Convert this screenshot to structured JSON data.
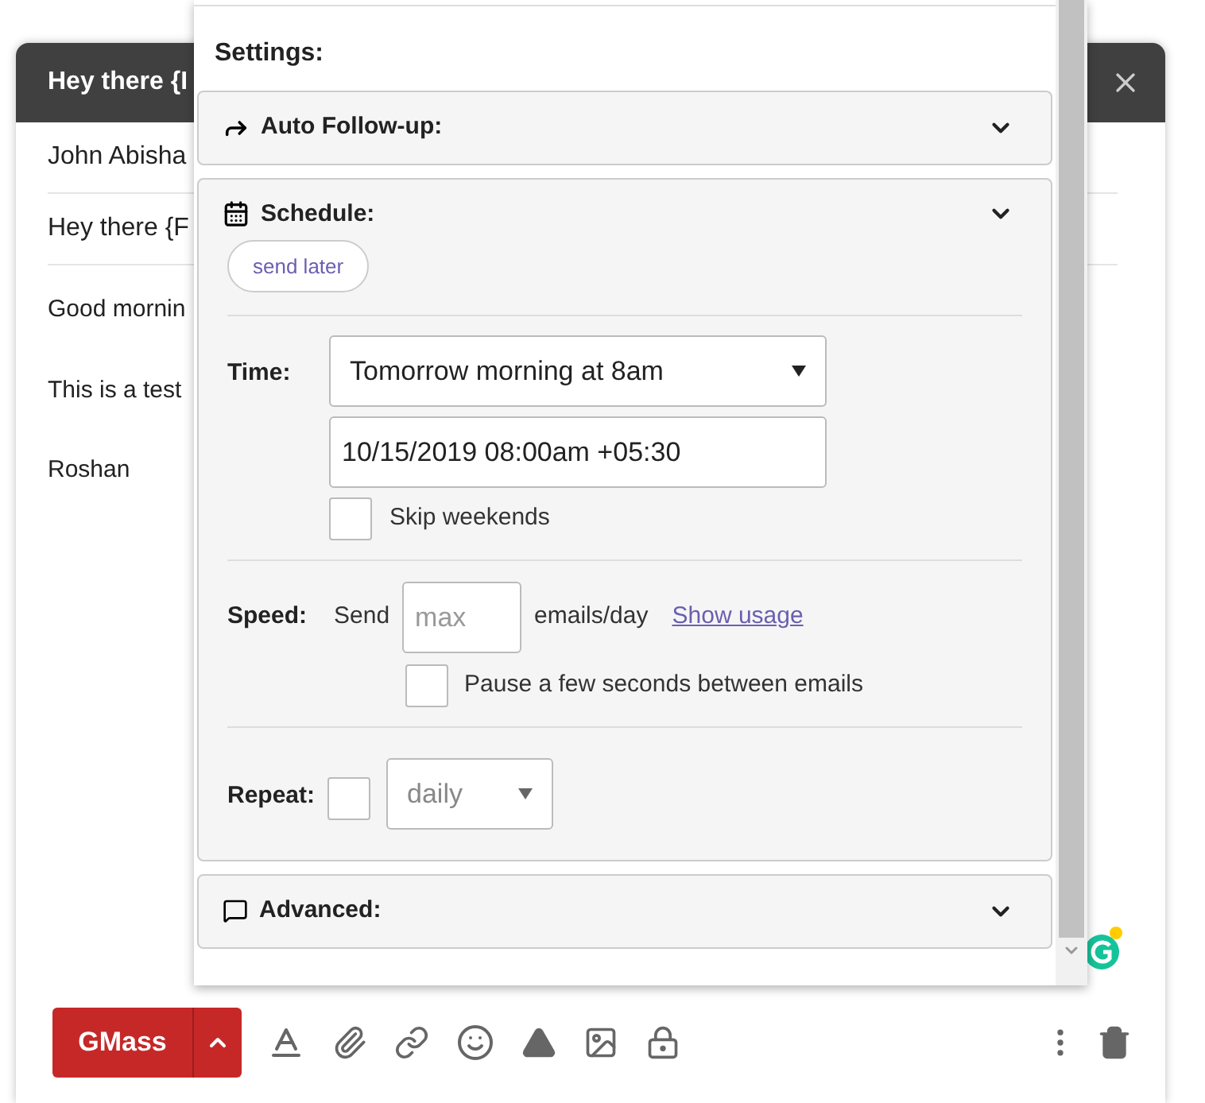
{
  "compose": {
    "title": "Hey there {I",
    "fields": [
      "John Abisha",
      "Hey there {F"
    ],
    "body": [
      "Good mornin",
      "This is a test",
      "Roshan"
    ]
  },
  "gmass_panel": {
    "heading": "Settings:",
    "sections": [
      {
        "kind": "followup",
        "title": "Auto Follow-up:"
      },
      {
        "kind": "schedule",
        "title": "Schedule:"
      },
      {
        "kind": "advanced",
        "title": "Advanced:"
      }
    ],
    "schedule": {
      "button": "send later",
      "time_label": "Time:",
      "time_value": "Tomorrow morning at 8am",
      "datetime": "10/15/2019 08:00am +05:30",
      "skip_weekends": {
        "label": "Skip weekends",
        "checked": false
      },
      "speed": {
        "label": "Speed:",
        "send": "Send",
        "placeholder": "max",
        "unit": "emails/day",
        "link": "Show usage",
        "pause": {
          "label": "Pause a few seconds between emails",
          "checked": false
        }
      },
      "repeat": {
        "label": "Repeat:",
        "checked": false,
        "frequency": "daily"
      }
    }
  },
  "toolbar": {
    "send_button": "GMass"
  }
}
